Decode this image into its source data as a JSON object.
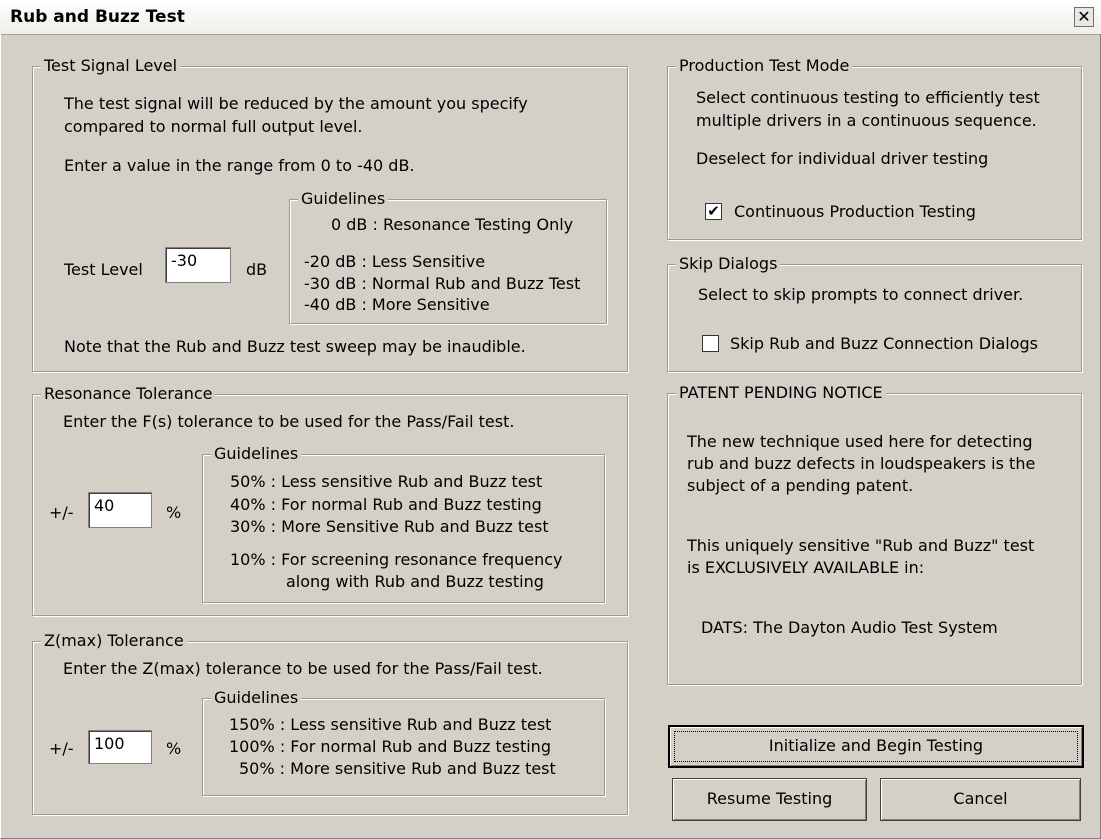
{
  "window": {
    "title": "Rub and Buzz Test",
    "close_glyph": "✕"
  },
  "test_signal": {
    "legend": "Test Signal Level",
    "desc1": "The test signal will be reduced by the amount you specify",
    "desc2": "compared to normal full output level.",
    "range": "Enter a value in the range from 0 to -40 dB.",
    "level_label": "Test Level",
    "level_value": "-30",
    "unit": "dB",
    "guidelines_legend": "Guidelines",
    "guidelines": [
      "0 dB : Resonance Testing Only",
      "-20 dB : Less Sensitive",
      "-30 dB : Normal Rub and Buzz Test",
      "-40 dB : More Sensitive"
    ],
    "note": "Note that the Rub and Buzz test sweep may be inaudible."
  },
  "resonance": {
    "legend": "Resonance Tolerance",
    "desc": "Enter the F(s) tolerance to be used for the Pass/Fail test.",
    "pm_label": "+/-",
    "value": "40",
    "unit": "%",
    "guidelines_legend": "Guidelines",
    "guidelines": [
      "50% : Less sensitive Rub and Buzz test",
      "40% : For normal Rub and Buzz testing",
      "30% : More Sensitive Rub and Buzz test",
      "10% : For screening resonance frequency",
      "along with Rub and Buzz testing"
    ]
  },
  "zmax": {
    "legend": "Z(max) Tolerance",
    "desc": "Enter the Z(max) tolerance to be used for the Pass/Fail test.",
    "pm_label": "+/-",
    "value": "100",
    "unit": "%",
    "guidelines_legend": "Guidelines",
    "guidelines": [
      "150% : Less sensitive Rub and Buzz test",
      "100% : For normal Rub and Buzz testing",
      "50% : More sensitive Rub and Buzz test"
    ]
  },
  "production": {
    "legend": "Production Test Mode",
    "desc1": "Select continuous testing to efficiently test",
    "desc2": "multiple drivers in a continuous sequence.",
    "desc3": "Deselect for individual driver testing",
    "checkbox_label": "Continuous Production Testing",
    "checked_glyph": "✔",
    "checked": true
  },
  "skip": {
    "legend": "Skip Dialogs",
    "desc": "Select to skip prompts to connect driver.",
    "checkbox_label": "Skip Rub and Buzz Connection Dialogs",
    "checked": false
  },
  "patent": {
    "legend": "PATENT PENDING NOTICE",
    "line1": "The new technique used here for detecting",
    "line2": "rub and buzz defects in loudspeakers is the",
    "line3": "subject of a pending patent.",
    "line4": "This uniquely sensitive \"Rub and Buzz\" test",
    "line5": "is EXCLUSIVELY AVAILABLE in:",
    "line6": "DATS: The Dayton Audio Test System"
  },
  "buttons": {
    "initialize": "Initialize and Begin Testing",
    "resume": "Resume Testing",
    "cancel": "Cancel"
  }
}
